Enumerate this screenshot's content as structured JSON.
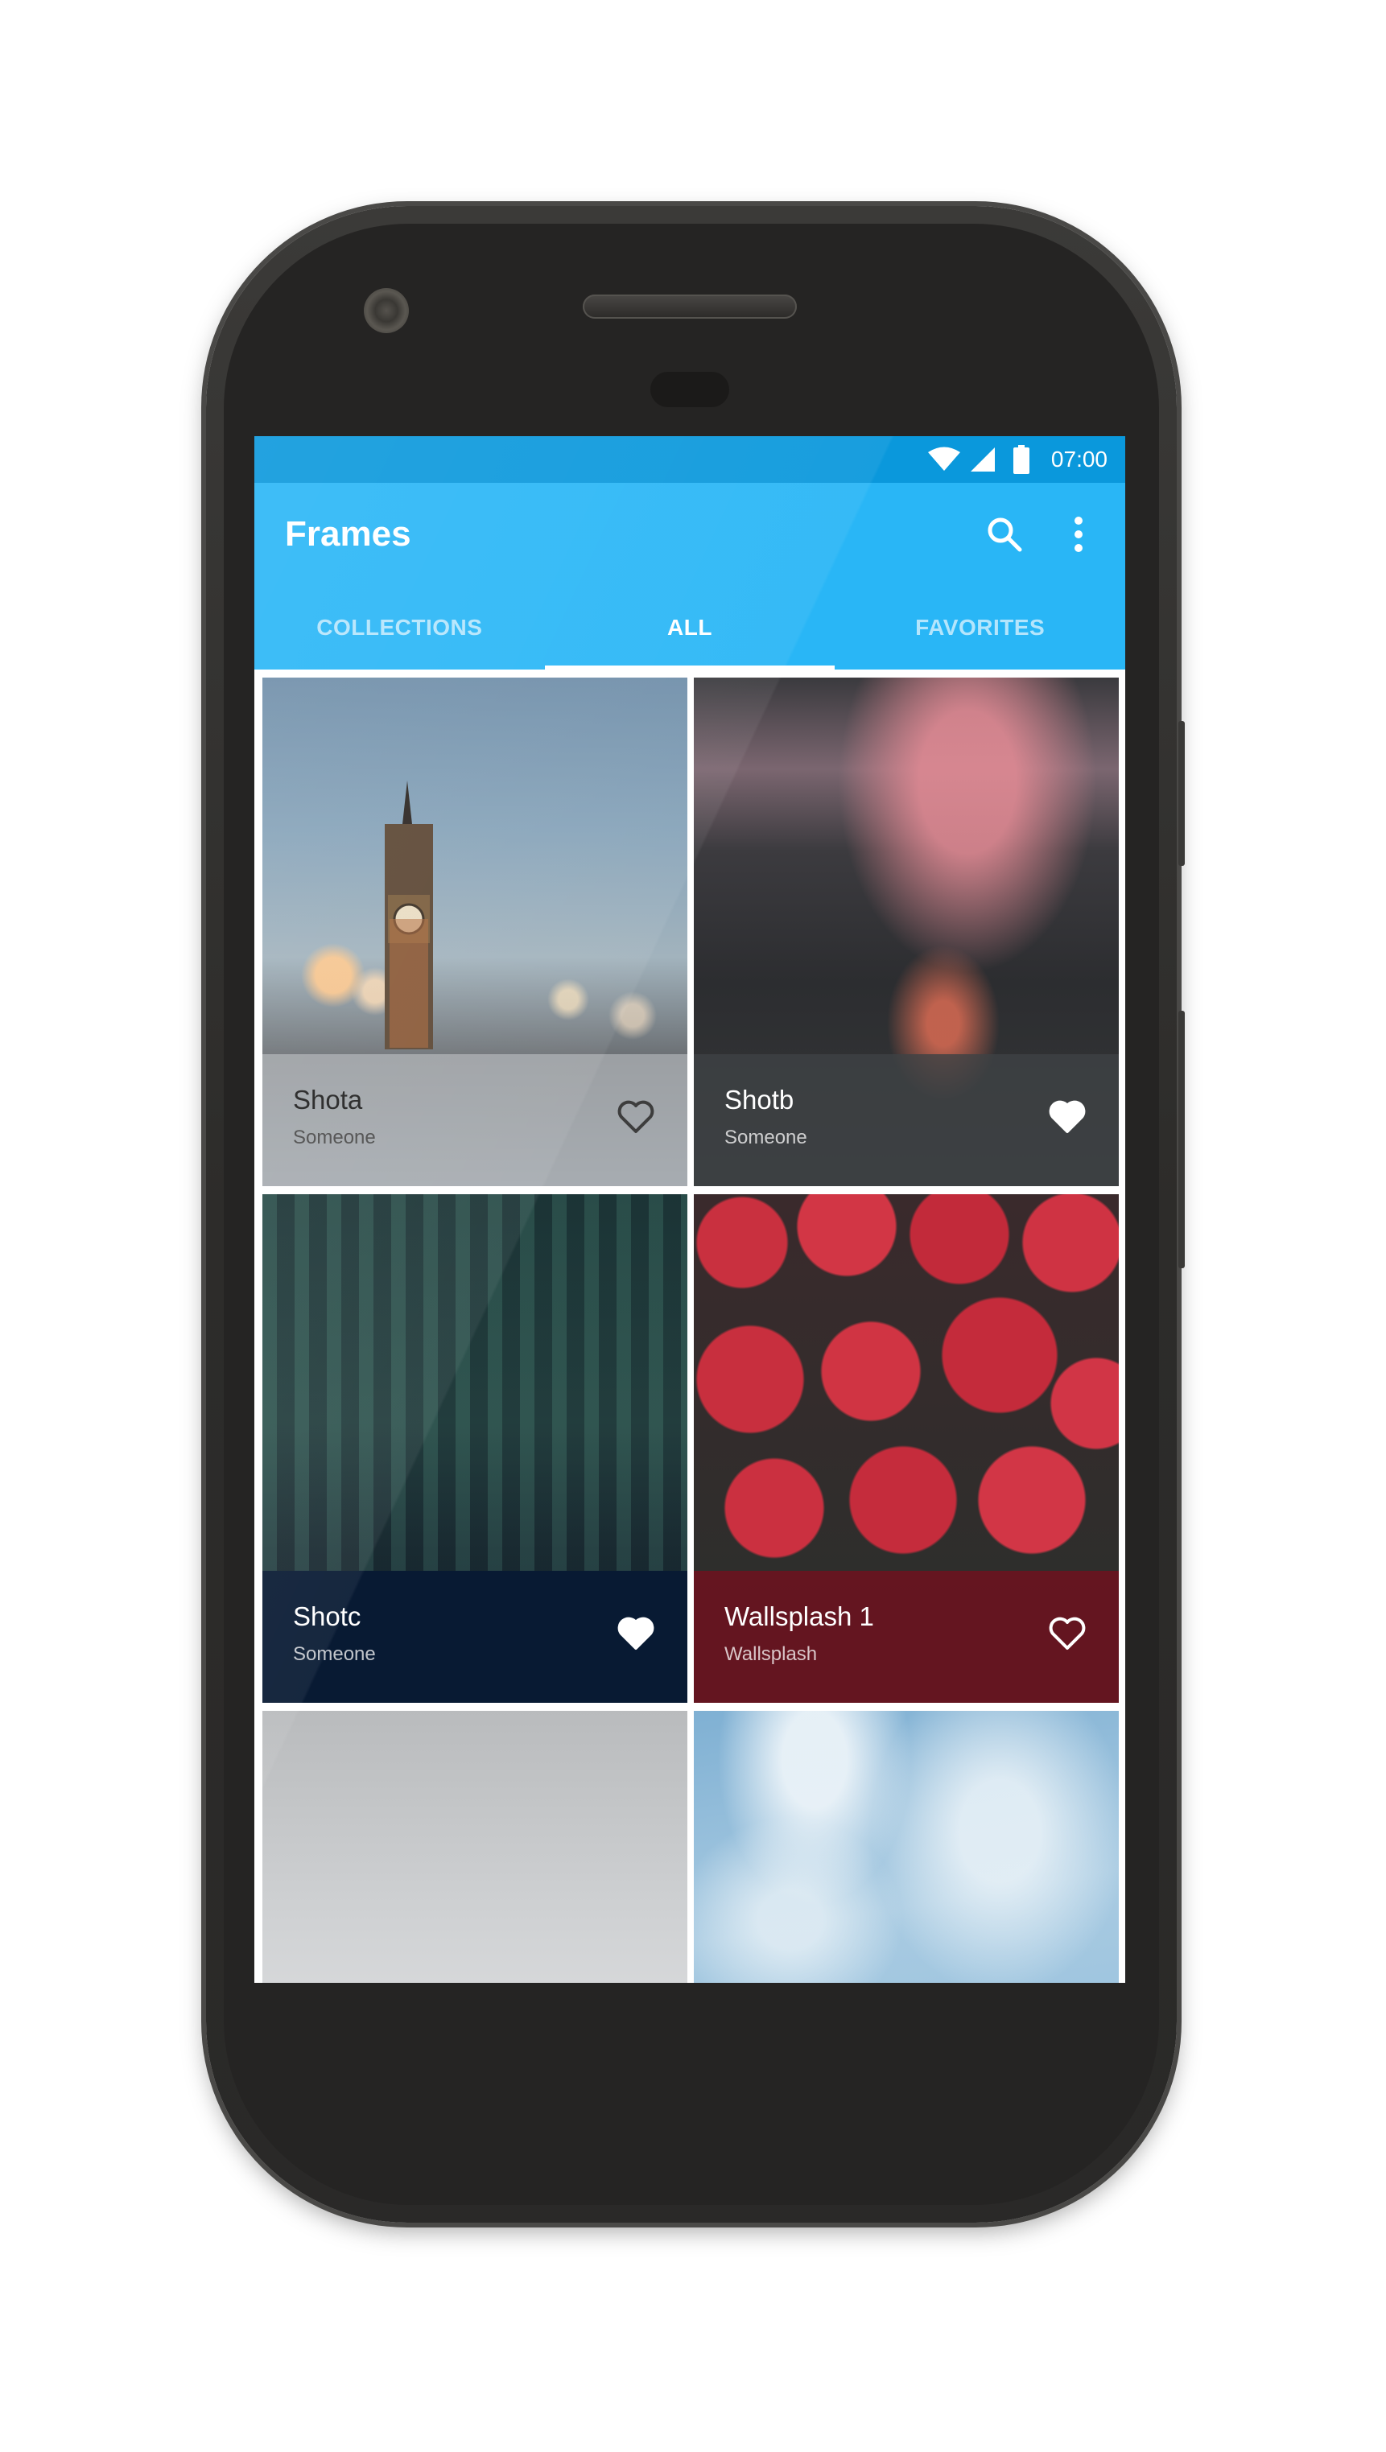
{
  "status_bar": {
    "time": "07:00",
    "icons": [
      "wifi-icon",
      "cell-signal-icon",
      "battery-icon"
    ]
  },
  "app_bar": {
    "title": "Frames",
    "actions": [
      "search-icon",
      "more-vert-icon"
    ]
  },
  "tabs": [
    {
      "label": "COLLECTIONS",
      "active": false
    },
    {
      "label": "ALL",
      "active": true
    },
    {
      "label": "FAVORITES",
      "active": false
    }
  ],
  "wallpapers": [
    {
      "title": "Shota",
      "author": "Someone",
      "favorited": false,
      "image": "clock-tower-bokeh"
    },
    {
      "title": "Shotb",
      "author": "Someone",
      "favorited": true,
      "image": "night-road-clouds"
    },
    {
      "title": "Shotc",
      "author": "Someone",
      "favorited": true,
      "image": "city-aerial"
    },
    {
      "title": "Wallsplash 1",
      "author": "Wallsplash",
      "favorited": false,
      "image": "strawberries"
    },
    {
      "title": "",
      "author": "",
      "favorited": false,
      "image": "snowy-mountain"
    },
    {
      "title": "",
      "author": "",
      "favorited": false,
      "image": "blue-sky-clouds"
    }
  ],
  "colors": {
    "status_bar": "#0a98dc",
    "app_bar": "#29b6f6",
    "accent": "#ffffff",
    "device": "#2d2c2a"
  }
}
